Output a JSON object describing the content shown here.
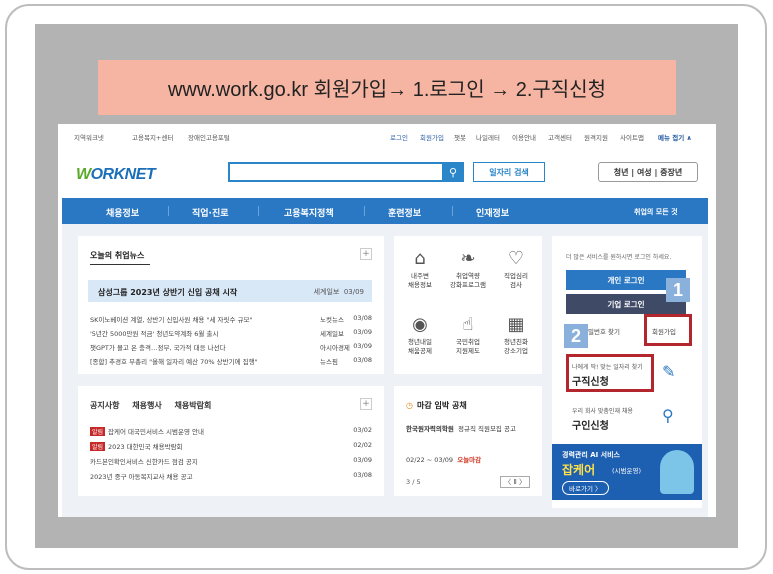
{
  "banner": {
    "text": "www.work.go.kr 회원가입→ 1.로그인 → 2.구직신청"
  },
  "util": {
    "left": [
      "지역워크넷",
      "고용복지+센터",
      "장애인고용포털"
    ],
    "right": [
      "로그인",
      "회원가입",
      "챗봇",
      "나일레터",
      "이용안내",
      "고객센터",
      "원격지원",
      "사이트맵"
    ],
    "menu_all": "메뉴 접기 ∧"
  },
  "logo": {
    "w": "W",
    "rest": "ORKNET"
  },
  "search": {
    "placeholder": "",
    "button_icon": "search-icon",
    "job_search": "일자리 검색"
  },
  "age": {
    "label": "청년 | 여성 | 중장년"
  },
  "gnb": {
    "items": [
      "채용정보",
      "직업·진로",
      "고용복지정책",
      "훈련정보",
      "인재정보"
    ],
    "all": "취업의 모든 것"
  },
  "news": {
    "title": "오늘의 취업뉴스",
    "headline": {
      "title": "삼성그룹 2023년 상반기 신입 공채 시작",
      "source": "세계일보",
      "date": "03/09"
    },
    "items": [
      {
        "title": "SK이노베이션 계열, 상반기 신입사원 채용 \"세 자릿수 규모\"",
        "source": "노컷뉴스",
        "date": "03/08"
      },
      {
        "title": "'5년간 5000만원 적금' 청년도약계좌 6월 출시",
        "source": "세계일보",
        "date": "03/09"
      },
      {
        "title": "챗GPT가 몰고 온 충격…정부, 국가적 대응 나선다",
        "source": "아시아경제",
        "date": "03/09"
      },
      {
        "title": "[종합] 추경호 부총리 \"올해 일자리 예산 70% 상반기에 집행\"",
        "source": "뉴스핌",
        "date": "03/08"
      }
    ]
  },
  "services": [
    {
      "label1": "내주변",
      "label2": "채용정보",
      "icon": "house-icon"
    },
    {
      "label1": "취업역량",
      "label2": "강화프로그램",
      "icon": "sprout-icon"
    },
    {
      "label1": "직업심리",
      "label2": "검사",
      "icon": "heart-check-icon"
    },
    {
      "label1": "청년내일",
      "label2": "채움공제",
      "icon": "piggy-bank-icon"
    },
    {
      "label1": "국민취업",
      "label2": "지원제도",
      "icon": "thumbs-up-icon"
    },
    {
      "label1": "청년친화",
      "label2": "강소기업",
      "icon": "building-icon"
    }
  ],
  "notice": {
    "tabs": [
      "공지사항",
      "채용행사",
      "채용박람회"
    ],
    "items": [
      {
        "badge": "알림",
        "title": "잡케어 대국민서비스 시범운영 안내",
        "date": "03/02"
      },
      {
        "badge": "알림",
        "title": "2023 대한민국 채용박람회",
        "date": "02/02"
      },
      {
        "badge": "",
        "title": "카드본인확인서비스 신한카드 점검 공지",
        "date": "03/09"
      },
      {
        "badge": "",
        "title": "2023년 중구 아동복지교사 채용 공고",
        "date": "03/08"
      }
    ]
  },
  "deadline": {
    "title": "마감 임박 공채",
    "company": "한국원자력의학원",
    "job": "정규직 직원모집 공고",
    "range": "02/22 ~ 03/09",
    "today": "오늘마감",
    "page": "3 / 5",
    "controls": "〈 Ⅱ 〉"
  },
  "side": {
    "message": "더 많은 서비스를 원하시면 로그인 하세요.",
    "personal_login": "개인 로그인",
    "company_login": "기업 로그인",
    "find_pw": "비밀번호 찾기",
    "signup": "회원가입",
    "job_sub": "나에게 딱! 맞는 일자리 찾기",
    "job_main": "구직신청",
    "talent_sub": "우리 회사 맞춤인재 채용",
    "talent_main": "구인신청",
    "ad_line1": "경력관리 AI 서비스",
    "ad_line2": "잡케어",
    "ad_line3": "(시범운영)",
    "ad_button": "바로가기 〉"
  },
  "markers": {
    "one": "1",
    "two": "2"
  }
}
